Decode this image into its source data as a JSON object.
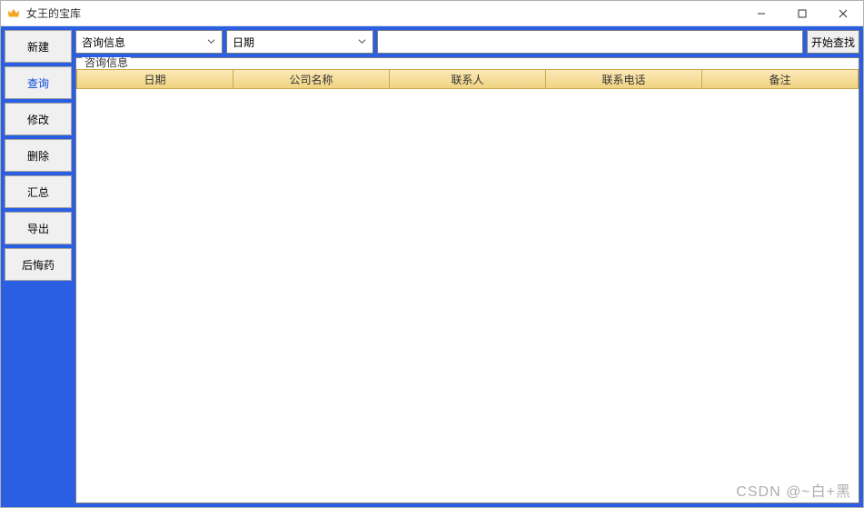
{
  "window": {
    "title": "女王的宝库"
  },
  "sidebar": {
    "items": [
      {
        "label": "新建"
      },
      {
        "label": "查询"
      },
      {
        "label": "修改"
      },
      {
        "label": "删除"
      },
      {
        "label": "汇总"
      },
      {
        "label": "导出"
      },
      {
        "label": "后悔药"
      }
    ],
    "active_index": 1
  },
  "toolbar": {
    "select1": "咨询信息",
    "select2": "日期",
    "search_value": "",
    "search_button": "开始查找"
  },
  "panel": {
    "legend": "咨询信息",
    "columns": [
      "日期",
      "公司名称",
      "联系人",
      "联系电话",
      "备注"
    ],
    "rows": []
  },
  "watermark": "CSDN @~白+黑"
}
